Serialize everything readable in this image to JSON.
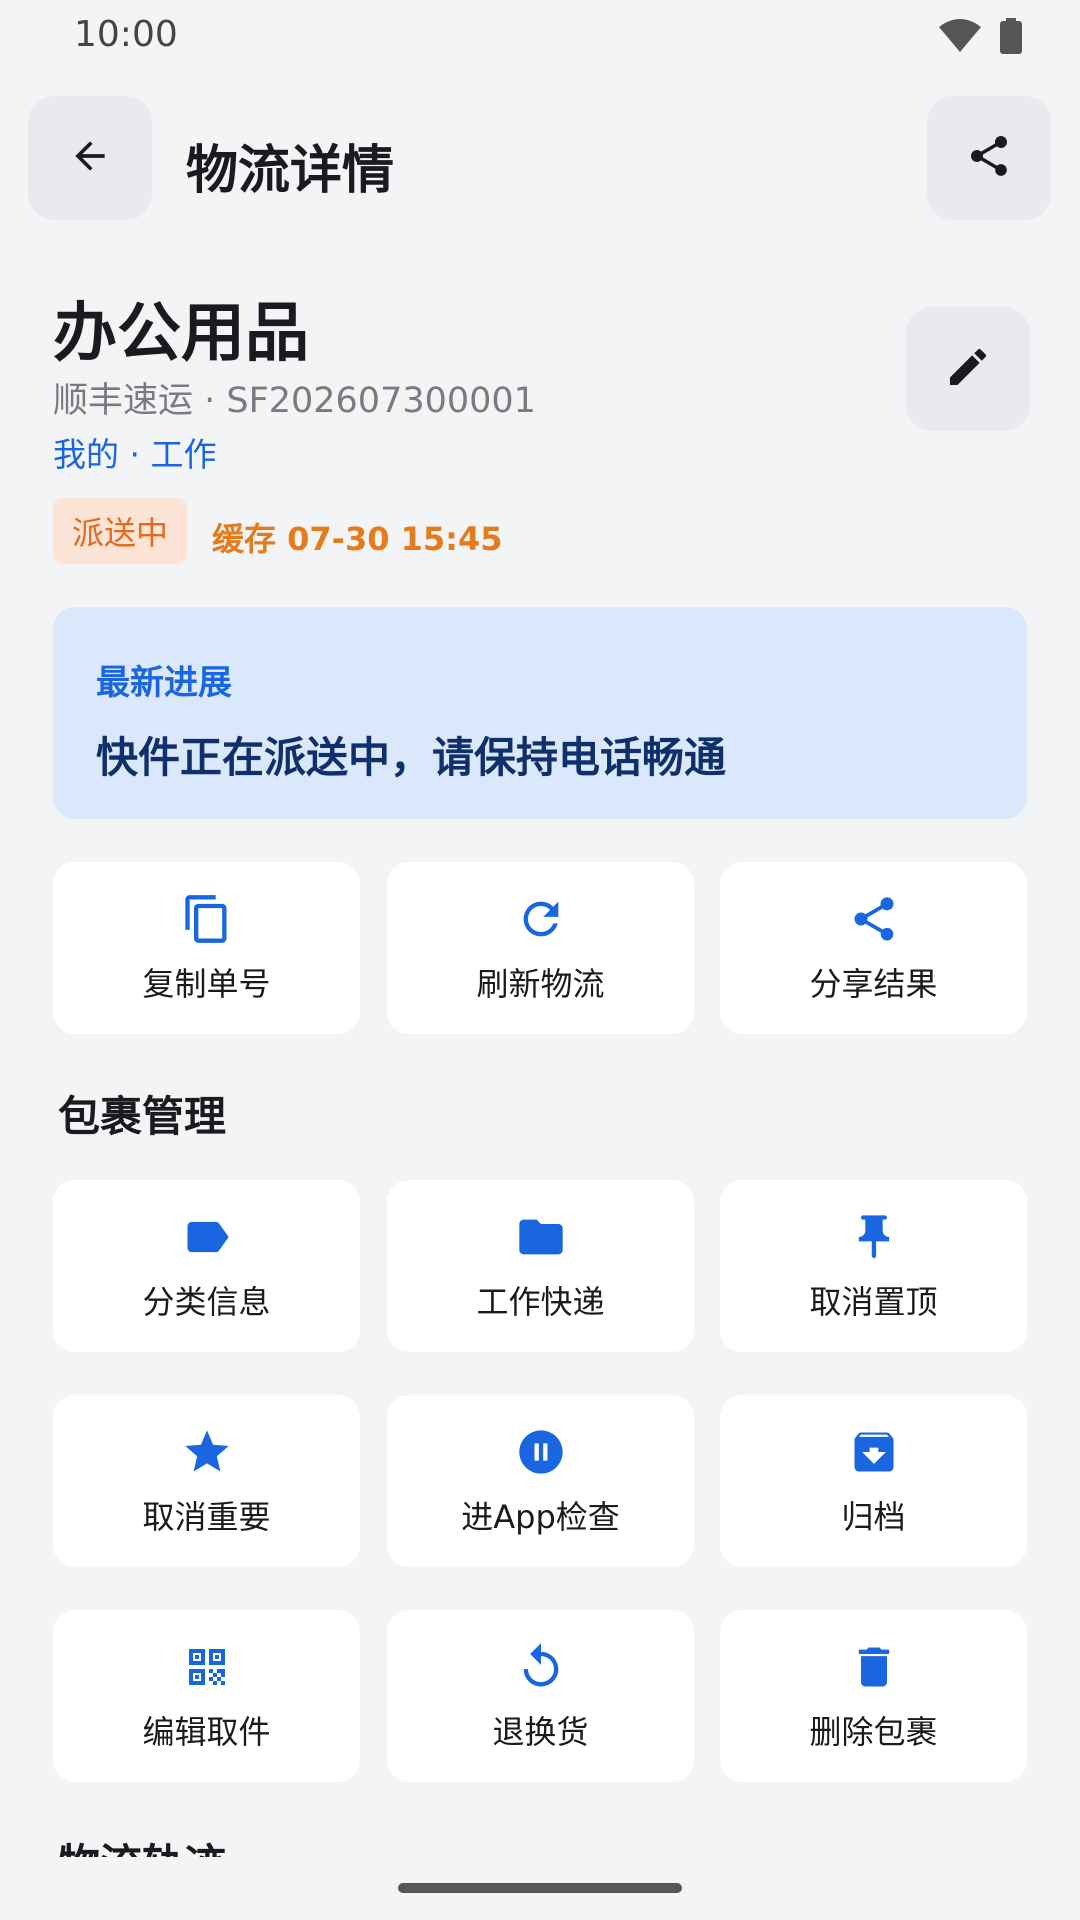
{
  "status_bar": {
    "time": "10:00"
  },
  "app_bar": {
    "title": "物流详情"
  },
  "package": {
    "name": "办公用品",
    "carrier_line": "顺丰速运 · SF202607300001",
    "tags": "我的 · 工作",
    "status": "派送中",
    "cache_time": "缓存 07-30 15:45"
  },
  "latest": {
    "label": "最新进展",
    "message": "快件正在派送中，请保持电话畅通"
  },
  "quick_actions": [
    {
      "label": "复制单号",
      "icon": "copy-icon"
    },
    {
      "label": "刷新物流",
      "icon": "refresh-icon"
    },
    {
      "label": "分享结果",
      "icon": "share-icon"
    }
  ],
  "management": {
    "title": "包裹管理",
    "items": [
      {
        "label": "分类信息",
        "icon": "label-icon"
      },
      {
        "label": "工作快递",
        "icon": "folder-icon"
      },
      {
        "label": "取消置顶",
        "icon": "pin-icon"
      },
      {
        "label": "取消重要",
        "icon": "star-icon"
      },
      {
        "label": "进App检查",
        "icon": "pause-circle-icon"
      },
      {
        "label": "归档",
        "icon": "archive-icon"
      },
      {
        "label": "编辑取件",
        "icon": "qr-code-icon"
      },
      {
        "label": "退换货",
        "icon": "undo-icon"
      },
      {
        "label": "删除包裹",
        "icon": "delete-icon"
      }
    ]
  },
  "tracking": {
    "title": "物流轨迹"
  },
  "colors": {
    "accent": "#1a66e0",
    "status": "#e26a1c",
    "background": "#f3f4f6",
    "latest_bg": "#dbe7fb"
  }
}
